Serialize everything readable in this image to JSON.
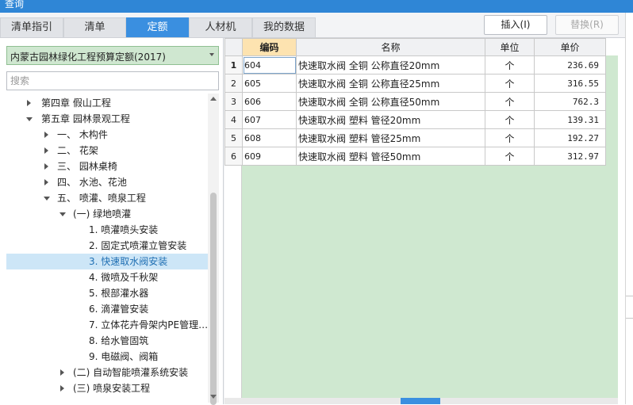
{
  "window": {
    "title": "查询"
  },
  "tabs": [
    {
      "label": "清单指引",
      "active": false
    },
    {
      "label": "清单",
      "active": false
    },
    {
      "label": "定额",
      "active": true
    },
    {
      "label": "人材机",
      "active": false
    },
    {
      "label": "我的数据",
      "active": false
    }
  ],
  "toolbar": {
    "insert_label": "插入(I)",
    "replace_label": "替换(R)"
  },
  "library_select": {
    "value": "内蒙古园林绿化工程预算定额(2017)"
  },
  "search": {
    "placeholder": "搜索",
    "value": ""
  },
  "tree": [
    {
      "label": "第四章 假山工程",
      "expand": "right"
    },
    {
      "label": "第五章 园林景观工程",
      "expand": "down"
    },
    {
      "label": "一、 木构件",
      "expand": "right"
    },
    {
      "label": "二、 花架",
      "expand": "right"
    },
    {
      "label": "三、 园林桌椅",
      "expand": "right"
    },
    {
      "label": "四、 水池、花池",
      "expand": "right"
    },
    {
      "label": "五、 喷灌、喷泉工程",
      "expand": "down"
    },
    {
      "label": "(一) 绿地喷灌",
      "expand": "down"
    },
    {
      "label": "1. 喷灌喷头安装",
      "expand": "none"
    },
    {
      "label": "2. 固定式喷灌立管安装",
      "expand": "none"
    },
    {
      "label": "3. 快速取水阀安装",
      "expand": "none",
      "selected": true
    },
    {
      "label": "4. 微喷及千秋架",
      "expand": "none"
    },
    {
      "label": "5. 根部灌水器",
      "expand": "none"
    },
    {
      "label": "6. 滴灌管安装",
      "expand": "none"
    },
    {
      "label": "7. 立体花卉骨架内PE管理…",
      "expand": "none"
    },
    {
      "label": "8. 给水管固筑",
      "expand": "none"
    },
    {
      "label": "9. 电磁阀、阀箱",
      "expand": "none"
    },
    {
      "label": "(二) 自动智能喷灌系统安装",
      "expand": "right"
    },
    {
      "label": "(三) 喷泉安装工程",
      "expand": "right"
    }
  ],
  "grid": {
    "columns": [
      "编码",
      "名称",
      "单位",
      "单价"
    ],
    "rows": [
      {
        "n": "1",
        "code": "604",
        "name": "快速取水阀 全铜 公称直径20mm",
        "unit": "个",
        "price": "236.69"
      },
      {
        "n": "2",
        "code": "605",
        "name": "快速取水阀 全铜 公称直径25mm",
        "unit": "个",
        "price": "316.55"
      },
      {
        "n": "3",
        "code": "606",
        "name": "快速取水阀 全铜 公称直径50mm",
        "unit": "个",
        "price": "762.3"
      },
      {
        "n": "4",
        "code": "607",
        "name": "快速取水阀 塑料 管径20mm",
        "unit": "个",
        "price": "139.31"
      },
      {
        "n": "5",
        "code": "608",
        "name": "快速取水阀 塑料 管径25mm",
        "unit": "个",
        "price": "192.27"
      },
      {
        "n": "6",
        "code": "609",
        "name": "快速取水阀 塑料 管径50mm",
        "unit": "个",
        "price": "312.97"
      }
    ]
  },
  "colors": {
    "accent": "#3a8fe0",
    "grid_bg": "#cfe8d0",
    "header_highlight": "#fde3b0",
    "selection": "#cde6f7"
  }
}
